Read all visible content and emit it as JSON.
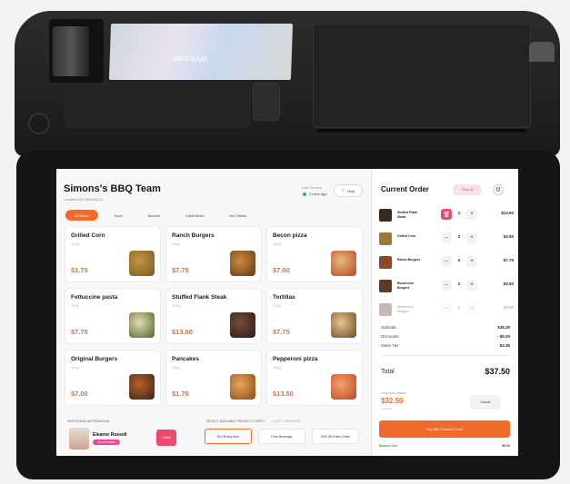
{
  "device": {
    "customer_screen_text": "Welcome"
  },
  "header": {
    "brand": "Simons's BBQ Team",
    "location": "Location ID# SIMON123",
    "sync_label": "Last Synced",
    "sync_value": "3 mins ago",
    "help_label": "Help",
    "help_icon": "help-circle-icon"
  },
  "tabs": [
    {
      "label": "All Menu",
      "active": true
    },
    {
      "label": "Food"
    },
    {
      "label": "Alcohol"
    },
    {
      "label": "Cold Drinks"
    },
    {
      "label": "Hot Drinks"
    }
  ],
  "menu": [
    {
      "name": "Grilled Corn",
      "weight": "150g",
      "price": "$1.75",
      "img_a": "#7a5a2a",
      "img_b": "#c3953f"
    },
    {
      "name": "Ranch Burgers",
      "weight": "150g",
      "price": "$7.75",
      "img_a": "#5a3a1e",
      "img_b": "#d08a3a"
    },
    {
      "name": "Becon pizza",
      "weight": "150g",
      "price": "$7.00",
      "img_a": "#b8472a",
      "img_b": "#e8b87a"
    },
    {
      "name": "Fettuccine pasta",
      "weight": "150g",
      "price": "$7.75",
      "img_a": "#4a6a2a",
      "img_b": "#e9d7b5"
    },
    {
      "name": "Stuffed Flank Steak",
      "weight": "150g",
      "price": "$13.50",
      "img_a": "#2a1e1a",
      "img_b": "#7a4a3a"
    },
    {
      "name": "Tortillas",
      "weight": "150g",
      "price": "$7.75",
      "img_a": "#6a4a2a",
      "img_b": "#e7c58a"
    },
    {
      "name": "Original Burgers",
      "weight": "150g",
      "price": "$7.00",
      "img_a": "#3a2418",
      "img_b": "#b4602a"
    },
    {
      "name": "Pancakes",
      "weight": "150g",
      "price": "$1.75",
      "img_a": "#8a4a1a",
      "img_b": "#e6a85a"
    },
    {
      "name": "Pepperoni pizza",
      "weight": "150g",
      "price": "$13.50",
      "img_a": "#c2412a",
      "img_b": "#f0a66a"
    }
  ],
  "customer": {
    "section_label": "WHITESAND INFORMATION",
    "name": "Eleanor Russell",
    "badge": "#CUSTOMER",
    "unlink_label": "Unlink"
  },
  "promos": {
    "label": "SELECT AVAILABLE PROMO TO APPLY",
    "label2": "(LAST 3 PROMOS)",
    "items": [
      "$3 Off Any Item",
      "Free Beverage",
      "20% Off Entire Order"
    ]
  },
  "order": {
    "title": "Current Order",
    "clear_label": "Clear All",
    "settings_icon": "gear-icon",
    "items": [
      {
        "name": "Stuffed Flank Steak",
        "qty": "1",
        "price": "$13.50",
        "img": "#3a2a22",
        "delete": true
      },
      {
        "name": "Grilled Corn",
        "qty": "2",
        "price": "$3.50",
        "img": "#9a7a3a"
      },
      {
        "name": "Ranch Burgers",
        "qty": "2",
        "price": "$7.75",
        "img": "#8a4a2a"
      },
      {
        "name": "Mushroom Burgers",
        "qty": "2",
        "price": "$3.50",
        "img": "#5a3a2a"
      },
      {
        "name": "Mushroom Burgers",
        "qty": "2",
        "price": "$3.50",
        "img": "#5a3a2a",
        "faded": true
      }
    ],
    "subtotal_label": "Subtotal",
    "subtotal": "$35.25",
    "discounts_label": "Discounts",
    "discounts": "- $5.00",
    "tax_label": "Sales Tax",
    "tax": "$3.35",
    "total_label": "Total",
    "total": "$37.50",
    "credit_label": "CASHLESS CREDIT",
    "credit_value": "$32.50",
    "credit_sub": "Available",
    "cancel_label": "Cancel",
    "pay_label": "Pay With Cashless Credit",
    "balance_label": "Balance Due",
    "balance": "$5.00"
  }
}
